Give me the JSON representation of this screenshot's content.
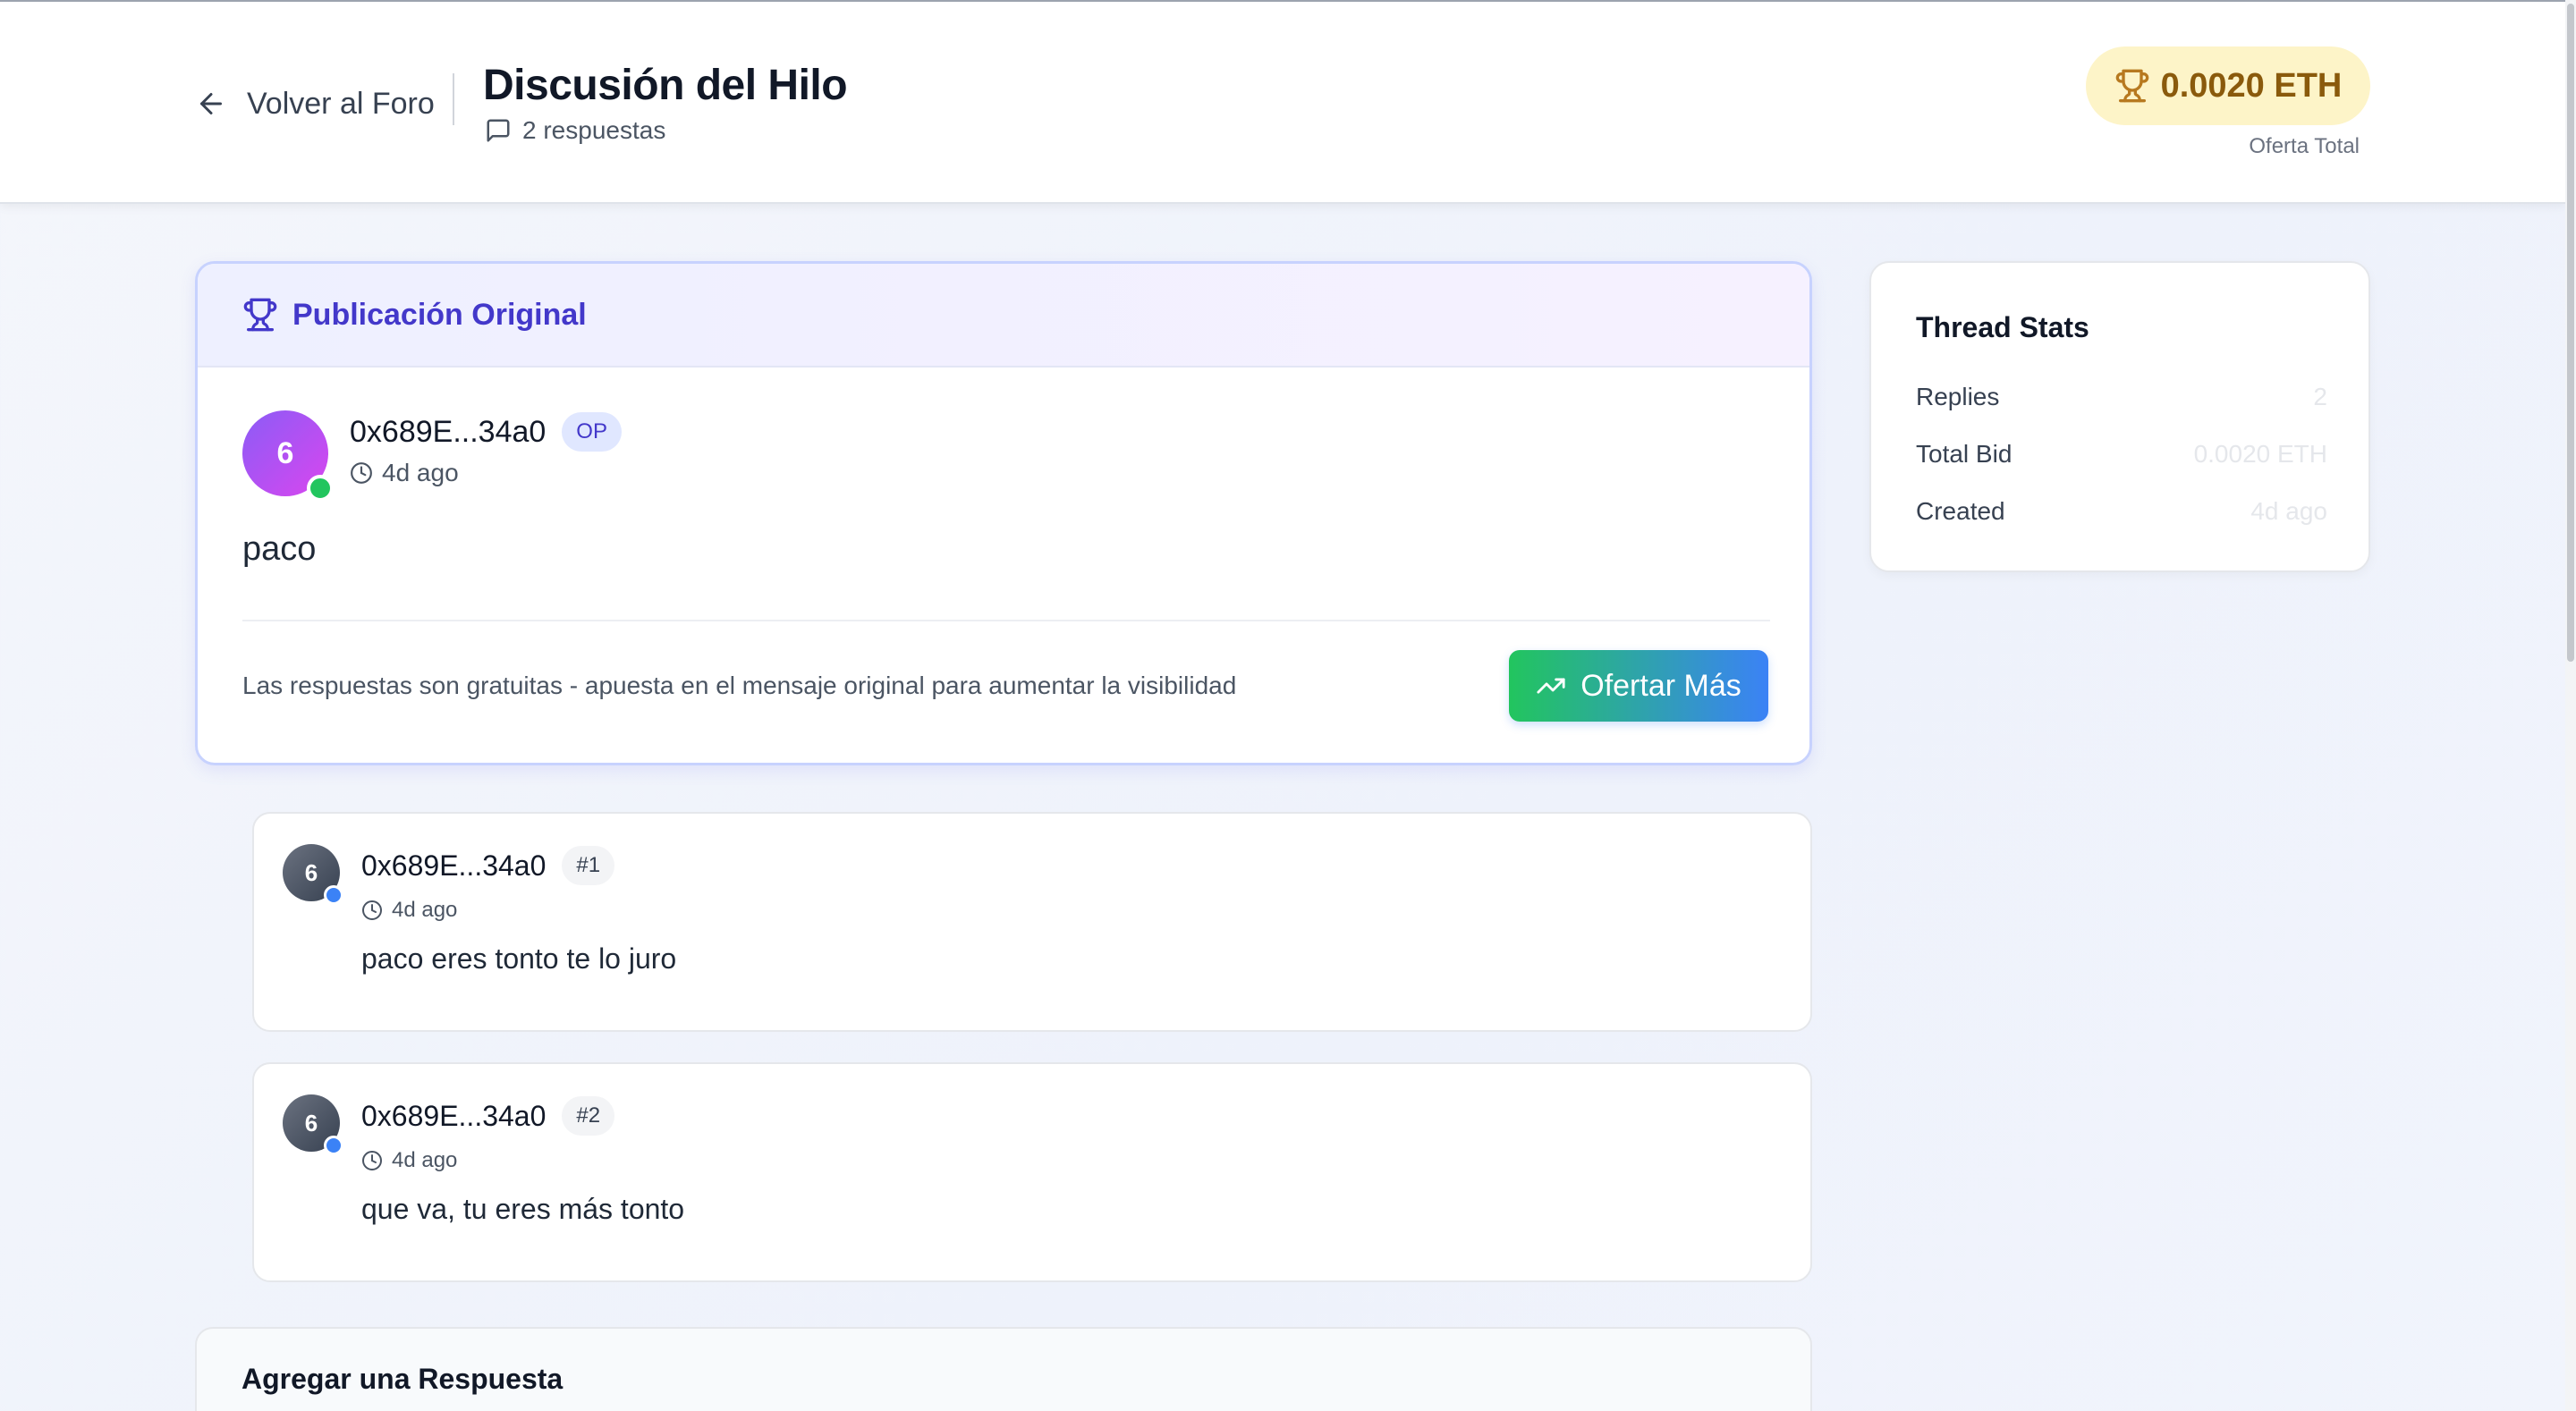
{
  "header": {
    "back_label": "Volver al Foro",
    "title": "Discusión del Hilo",
    "reply_count": "2 respuestas",
    "total_bid": "0.0020 ETH",
    "total_bid_caption": "Oferta Total"
  },
  "original_post": {
    "section_label": "Publicación Original",
    "avatar_initial": "6",
    "author": "0x689E...34a0",
    "badge": "OP",
    "time": "4d ago",
    "body": "paco",
    "note": "Las respuestas son gratuitas - apuesta en el mensaje original para aumentar la visibilidad",
    "bid_button_label": "Ofertar Más"
  },
  "replies": [
    {
      "avatar_initial": "6",
      "author": "0x689E...34a0",
      "number": "#1",
      "time": "4d ago",
      "body": "paco eres tonto te lo juro"
    },
    {
      "avatar_initial": "6",
      "author": "0x689E...34a0",
      "number": "#2",
      "time": "4d ago",
      "body": "que va, tu eres más tonto"
    }
  ],
  "add_reply": {
    "title": "Agregar una Respuesta"
  },
  "stats": {
    "title": "Thread Stats",
    "rows": [
      {
        "label": "Replies",
        "value": "2"
      },
      {
        "label": "Total Bid",
        "value": "0.0020 ETH"
      },
      {
        "label": "Created",
        "value": "4d ago"
      }
    ]
  },
  "icons": {
    "back": "arrow-left-icon",
    "replies": "message-square-icon",
    "trophy": "trophy-icon",
    "clock": "clock-icon",
    "trending": "trending-up-icon"
  },
  "colors": {
    "accent_indigo": "#4338ca",
    "bid_gold": "#8a5a0c",
    "online_green": "#22c55e",
    "reply_dot_blue": "#3b82f6"
  }
}
